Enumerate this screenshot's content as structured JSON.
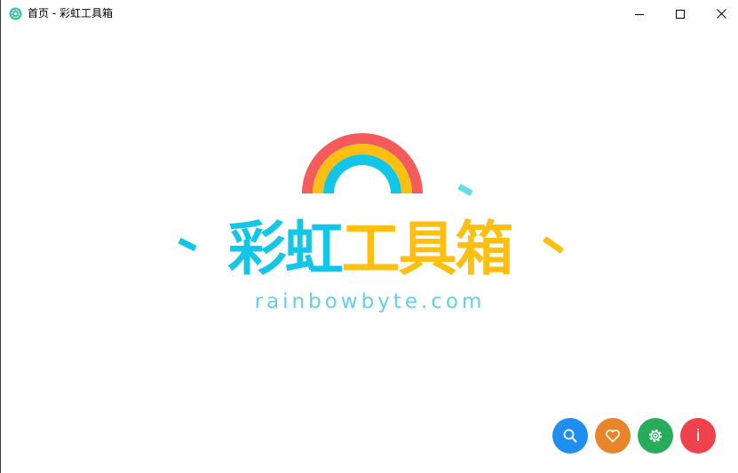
{
  "window": {
    "title": "首页 - 彩虹工具箱",
    "icon": "app-gear-icon",
    "controls": {
      "minimize": "minimize-icon",
      "maximize": "maximize-icon",
      "close": "close-icon"
    }
  },
  "logo": {
    "title_part1": "彩虹",
    "title_part2": "工具箱",
    "url": "rainbowbyte.com",
    "colors": {
      "red": "#f45b5b",
      "yellow": "#fdbf12",
      "cyan": "#11c6e6",
      "teal": "#5fe0dd"
    }
  },
  "actions": [
    {
      "id": "search",
      "icon": "search-icon",
      "color": "#1e8ff0"
    },
    {
      "id": "favorites",
      "icon": "heart-icon",
      "color": "#e8852a"
    },
    {
      "id": "settings",
      "icon": "gear-icon",
      "color": "#27ac5a"
    },
    {
      "id": "about",
      "icon": "info-icon",
      "label": "i",
      "color": "#f0424c"
    }
  ]
}
